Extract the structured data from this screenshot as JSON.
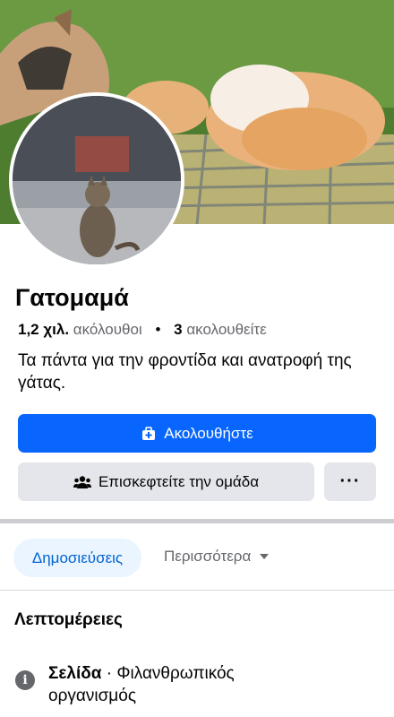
{
  "profile": {
    "name": "Γατομαμά",
    "followers_count": "1,2 χιλ.",
    "followers_label": "ακόλουθοι",
    "following_count": "3",
    "following_label": "ακολουθείτε",
    "separator": "•",
    "bio": "Τα πάντα για την φροντίδα και ανατροφή της γάτας."
  },
  "actions": {
    "follow_label": "Ακολουθήστε",
    "visit_group_label": "Επισκεφτείτε την ομάδα",
    "more_label": "···"
  },
  "tabs": {
    "posts_label": "Δημοσιεύσεις",
    "more_label": "Περισσότερα"
  },
  "details": {
    "title": "Λεπτομέρειες",
    "info_icon_glyph": "i",
    "type_label": "Σελίδα",
    "type_separator": " · ",
    "category": "Φιλανθρωπικός οργανισμός"
  },
  "colors": {
    "primary": "#0866ff",
    "secondary_button": "#e4e6eb",
    "tab_active_bg": "#ebf5ff",
    "tab_active_text": "#0064d1",
    "muted_text": "#65676b"
  },
  "icons": {
    "follow": "follow-icon",
    "group": "group-icon",
    "info": "info-icon",
    "dropdown": "caret-down-icon"
  }
}
